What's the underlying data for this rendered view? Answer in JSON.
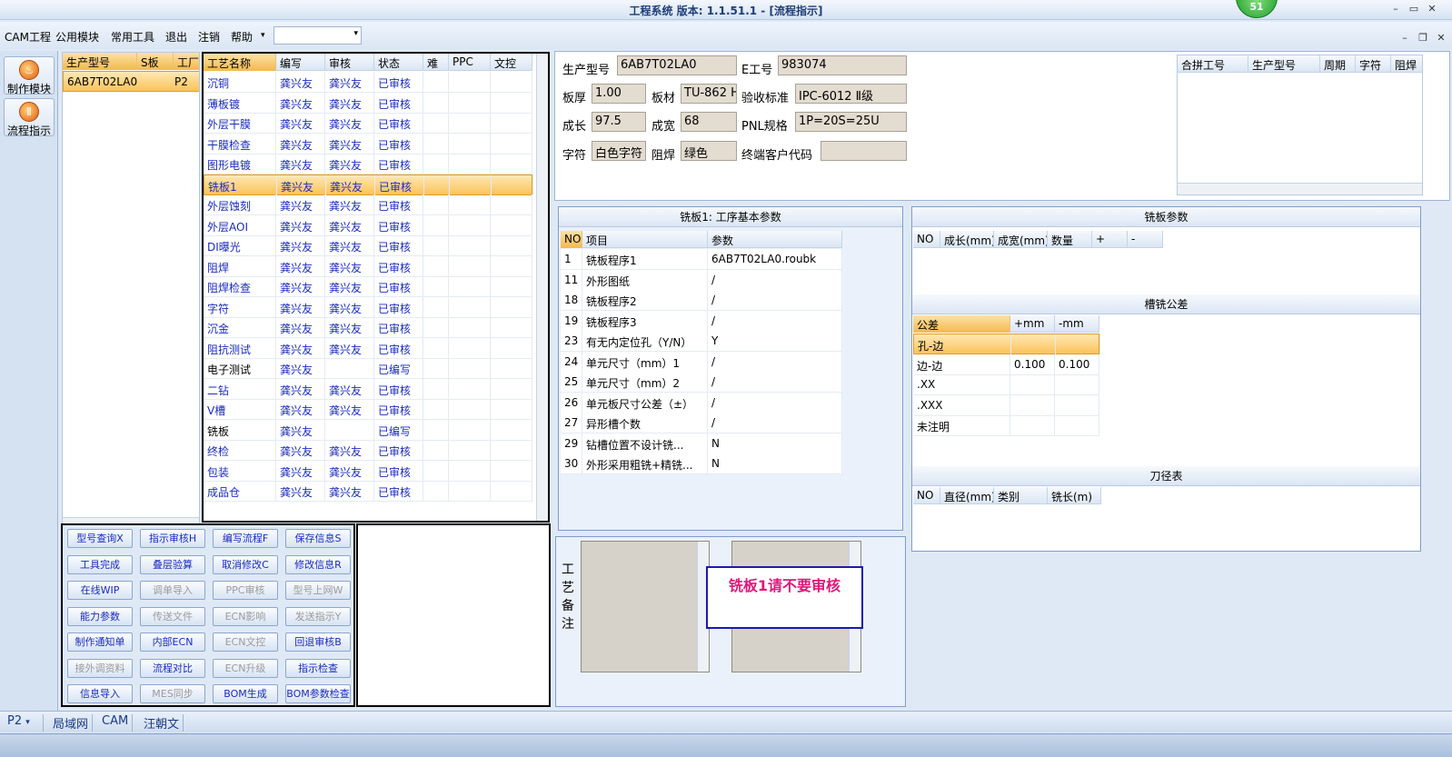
{
  "window": {
    "title": "工程系统  版本: 1.1.51.1 - [流程指示]",
    "badge": "51"
  },
  "menu": {
    "items": [
      "CAM工程",
      "公用模块",
      "常用工具",
      "退出",
      "注销",
      "帮助"
    ],
    "dropdown_arrow": "▾"
  },
  "nav": {
    "buttons": [
      {
        "label": "制作模块",
        "icon": "flame-icon"
      },
      {
        "label": "流程指示",
        "icon": "pause-circle-icon"
      }
    ]
  },
  "model_grid": {
    "headers": [
      "生产型号",
      "S板",
      "工厂"
    ],
    "rows": [
      [
        "6AB7T02LA0",
        "",
        "P2"
      ]
    ]
  },
  "process_grid": {
    "headers": [
      "工艺名称",
      "编写",
      "审核",
      "状态",
      "难",
      "PPC",
      "文控"
    ],
    "rows": [
      [
        "沉铜",
        "龚兴友",
        "龚兴友",
        "已审核"
      ],
      [
        "薄板镀",
        "龚兴友",
        "龚兴友",
        "已审核"
      ],
      [
        "外层干膜",
        "龚兴友",
        "龚兴友",
        "已审核"
      ],
      [
        "干膜检查",
        "龚兴友",
        "龚兴友",
        "已审核"
      ],
      [
        "图形电镀",
        "龚兴友",
        "龚兴友",
        "已审核"
      ],
      [
        "铣板1",
        "龚兴友",
        "龚兴友",
        "已审核"
      ],
      [
        "外层蚀刻",
        "龚兴友",
        "龚兴友",
        "已审核"
      ],
      [
        "外层AOI",
        "龚兴友",
        "龚兴友",
        "已审核"
      ],
      [
        "DI曝光",
        "龚兴友",
        "龚兴友",
        "已审核"
      ],
      [
        "阻焊",
        "龚兴友",
        "龚兴友",
        "已审核"
      ],
      [
        "阻焊检查",
        "龚兴友",
        "龚兴友",
        "已审核"
      ],
      [
        "字符",
        "龚兴友",
        "龚兴友",
        "已审核"
      ],
      [
        "沉金",
        "龚兴友",
        "龚兴友",
        "已审核"
      ],
      [
        "阻抗测试",
        "龚兴友",
        "龚兴友",
        "已审核"
      ],
      [
        "电子测试",
        "龚兴友",
        "",
        "已编写"
      ],
      [
        "二钻",
        "龚兴友",
        "龚兴友",
        "已审核"
      ],
      [
        "V槽",
        "龚兴友",
        "龚兴友",
        "已审核"
      ],
      [
        "铣板",
        "龚兴友",
        "",
        "已编写"
      ],
      [
        "终检",
        "龚兴友",
        "龚兴友",
        "已审核"
      ],
      [
        "包装",
        "龚兴友",
        "龚兴友",
        "已审核"
      ],
      [
        "成品仓",
        "龚兴友",
        "龚兴友",
        "已审核"
      ]
    ],
    "selected_index": 5,
    "plain_rows": [
      14,
      17
    ]
  },
  "actions": [
    [
      "型号查询X",
      "指示审核H",
      "编写流程F",
      "保存信息S"
    ],
    [
      "工具完成",
      "叠层验算",
      "取消修改C",
      "修改信息R"
    ],
    [
      "在线WIP",
      "调单导入",
      "PPC审核",
      "型号上网W"
    ],
    [
      "能力参数",
      "传送文件",
      "ECN影响",
      "发送指示Y"
    ],
    [
      "制作通知单",
      "内部ECN",
      "ECN文控",
      "回退审核B"
    ],
    [
      "接外调资料",
      "流程对比",
      "ECN升级",
      "指示检查"
    ],
    [
      "信息导入",
      "MES同步",
      "BOM生成",
      "BOM参数检查"
    ]
  ],
  "actions_disabled": [
    "调单导入",
    "PPC审核",
    "型号上网W",
    "传送文件",
    "ECN影响",
    "发送指示Y",
    "ECN文控",
    "接外调资料",
    "ECN升级",
    "MES同步"
  ],
  "info": {
    "prod_model_label": "生产型号",
    "prod_model": "6AB7T02LA0",
    "e_no_label": "E工号",
    "e_no": "983074",
    "thickness_label": "板厚",
    "thickness": "1.00",
    "material_label": "板材",
    "material": "TU-862 H",
    "standard_label": "验收标准",
    "standard": "IPC-6012 Ⅱ级",
    "length_label": "成长",
    "length": "97.5",
    "width_label": "成宽",
    "width": "68",
    "pnl_label": "PNL规格",
    "pnl": "1P=20S=25U",
    "char_label": "字符",
    "char": "白色字符",
    "mask_label": "阻焊",
    "mask": "绿色",
    "customer_label": "终端客户代码",
    "customer": ""
  },
  "combine_grid": {
    "headers": [
      "合拼工号",
      "生产型号",
      "周期",
      "字符",
      "阻焊"
    ]
  },
  "step_params": {
    "title": "铣板1: 工序基本参数",
    "headers": [
      "NO",
      "项目",
      "参数"
    ],
    "rows": [
      [
        "1",
        "铣板程序1",
        "6AB7T02LA0.roubk"
      ],
      [
        "11",
        "外形图纸",
        "/"
      ],
      [
        "18",
        "铣板程序2",
        "/"
      ],
      [
        "19",
        "铣板程序3",
        "/"
      ],
      [
        "23",
        "有无内定位孔（Y/N）",
        "Y"
      ],
      [
        "24",
        "单元尺寸（mm）1",
        "/"
      ],
      [
        "25",
        "单元尺寸（mm）2",
        "/"
      ],
      [
        "26",
        "单元板尺寸公差（±）",
        "/"
      ],
      [
        "27",
        "异形槽个数",
        "/"
      ],
      [
        "29",
        "钻槽位置不设计铣...",
        "N"
      ],
      [
        "30",
        "外形采用粗铣+精铣...",
        "N"
      ]
    ]
  },
  "mill_params": {
    "title": "铣板参数",
    "headers": [
      "NO",
      "成长(mm)",
      "成宽(mm)",
      "数量",
      "+",
      "-"
    ]
  },
  "slot_tol": {
    "title": "槽铣公差",
    "headers": [
      "公差",
      "+mm",
      "-mm"
    ],
    "rows": [
      [
        "孔-边",
        "",
        ""
      ],
      [
        "边-边",
        "0.100",
        "0.100"
      ],
      [
        ".XX",
        "",
        ""
      ],
      [
        ".XXX",
        "",
        ""
      ],
      [
        "未注明",
        "",
        ""
      ]
    ]
  },
  "tool_table": {
    "title": "刀径表",
    "headers": [
      "NO",
      "直径(mm)",
      "类别",
      "铣长(m)"
    ]
  },
  "remarks": {
    "label": "工艺备注",
    "popup": "铣板1请不要审核"
  },
  "status": {
    "factory": "P2",
    "items": [
      "局域网",
      "CAM",
      "汪朝文"
    ]
  }
}
